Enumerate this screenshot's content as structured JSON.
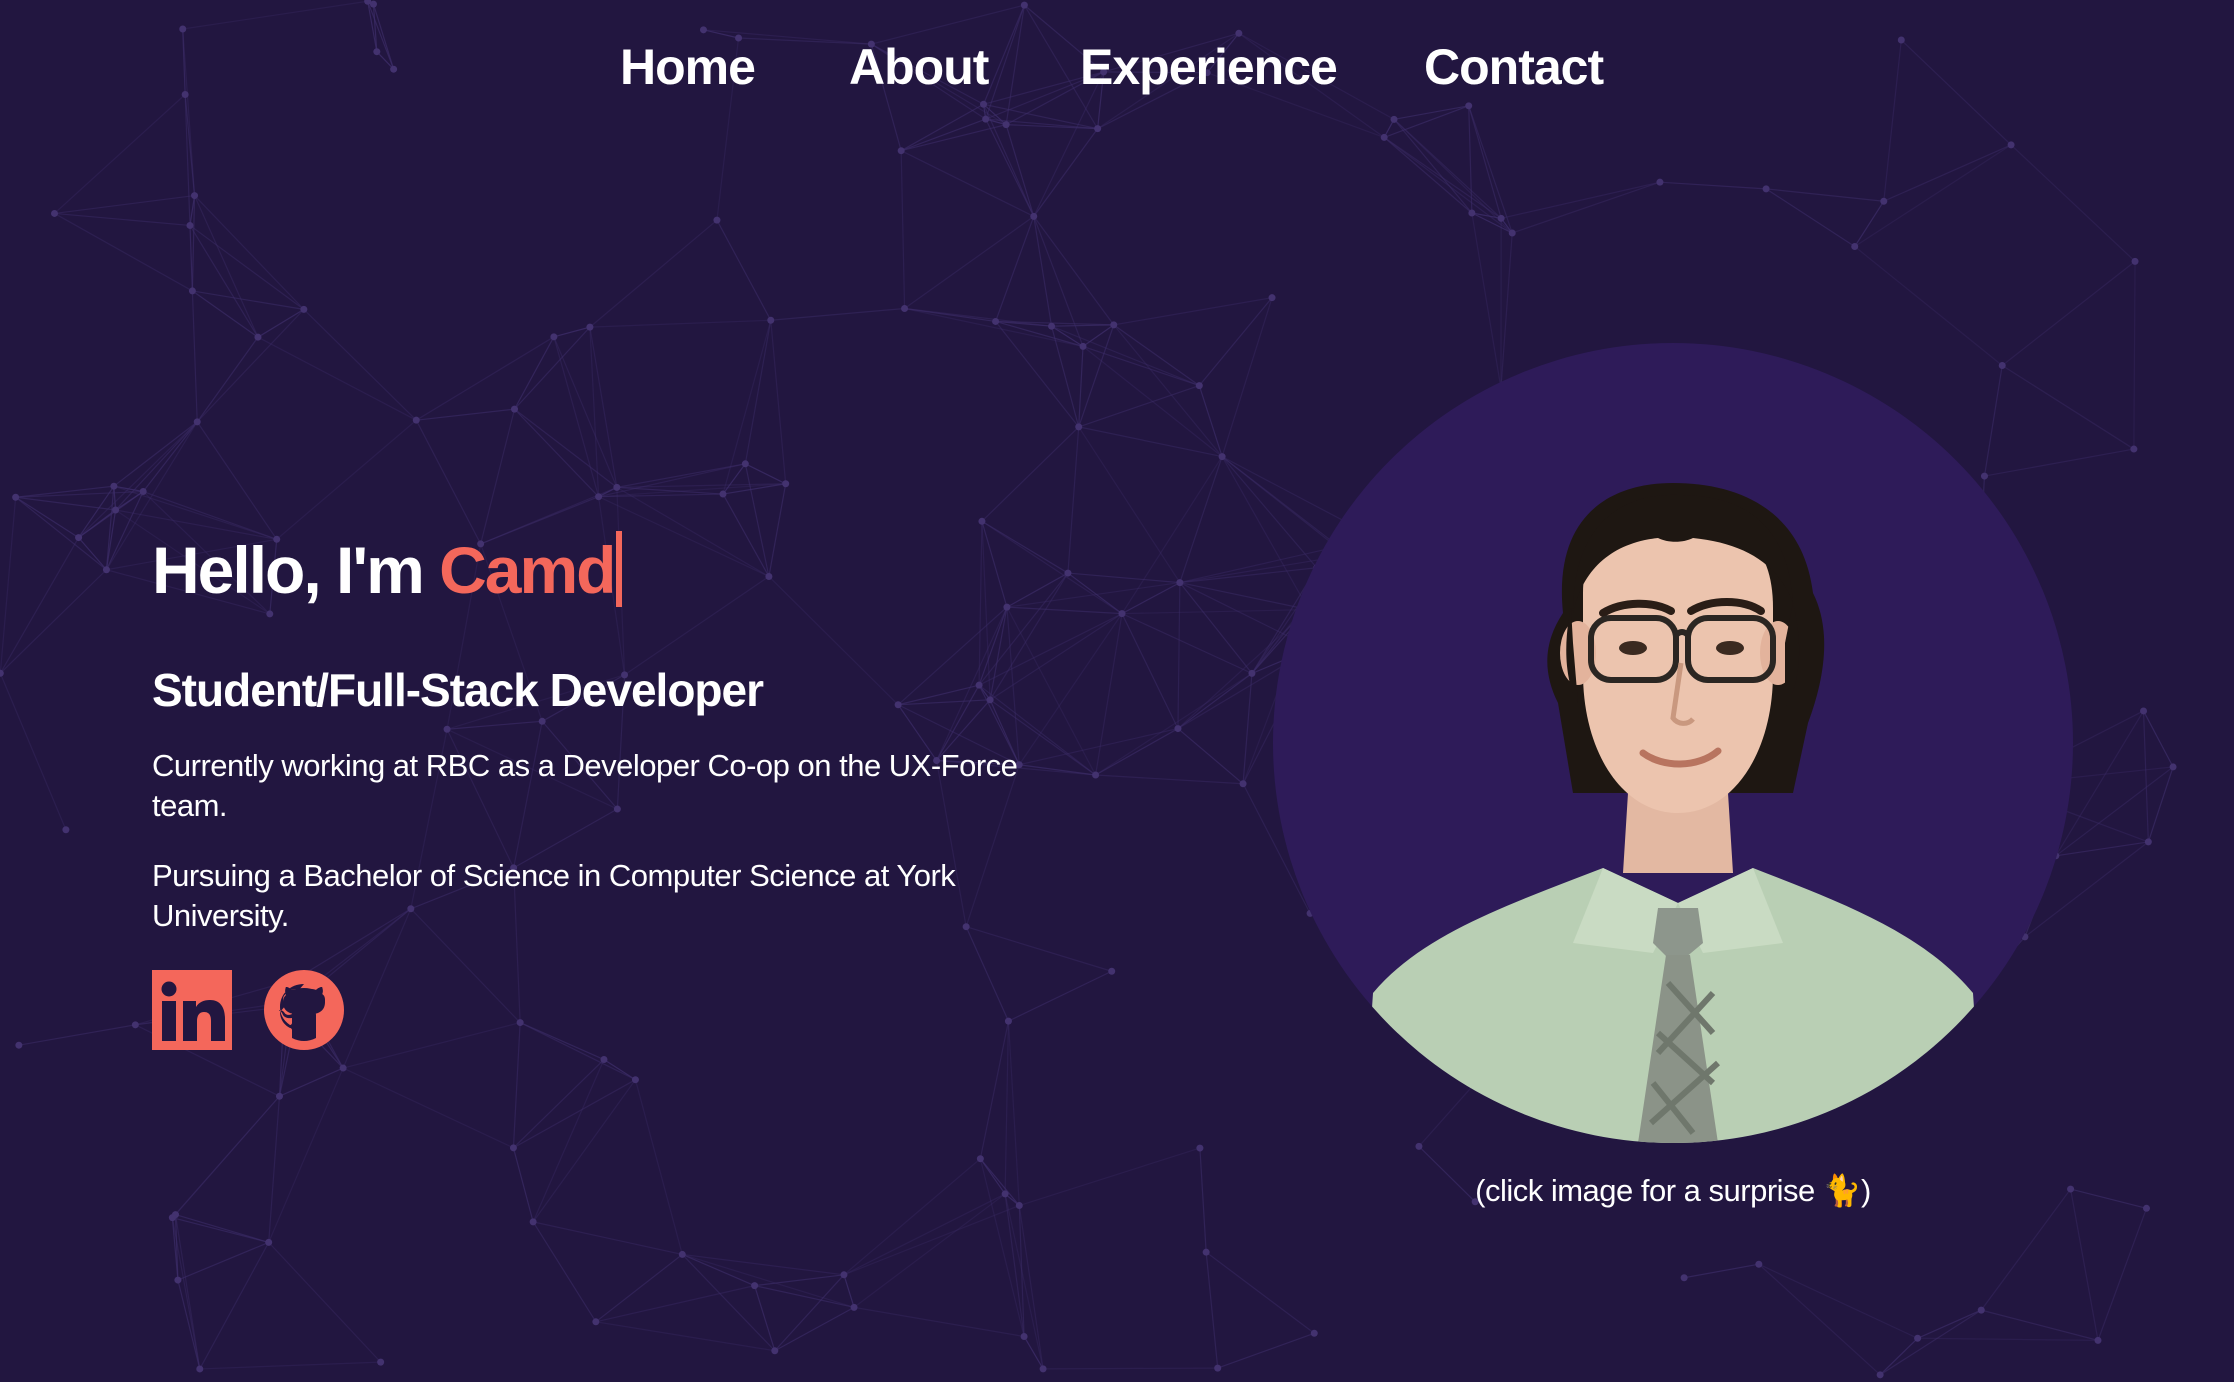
{
  "nav": {
    "items": [
      "Home",
      "About",
      "Experience",
      "Contact"
    ]
  },
  "hero": {
    "greeting_prefix": "Hello, I'm ",
    "typed_name": "Camd",
    "role": "Student/Full-Stack Developer",
    "paragraphs": [
      "Currently working at RBC as a Developer Co-op on the UX-Force team.",
      "Pursuing a Bachelor of Science in Computer Science at York University."
    ],
    "socials": [
      "linkedin-icon",
      "github-icon"
    ]
  },
  "portrait": {
    "caption": "(click image for a surprise 🐈)"
  },
  "colors": {
    "background": "#221640",
    "accent": "#f4675b",
    "portrait_bg": "#2e1b59",
    "network_lines": "#3d2d69"
  }
}
